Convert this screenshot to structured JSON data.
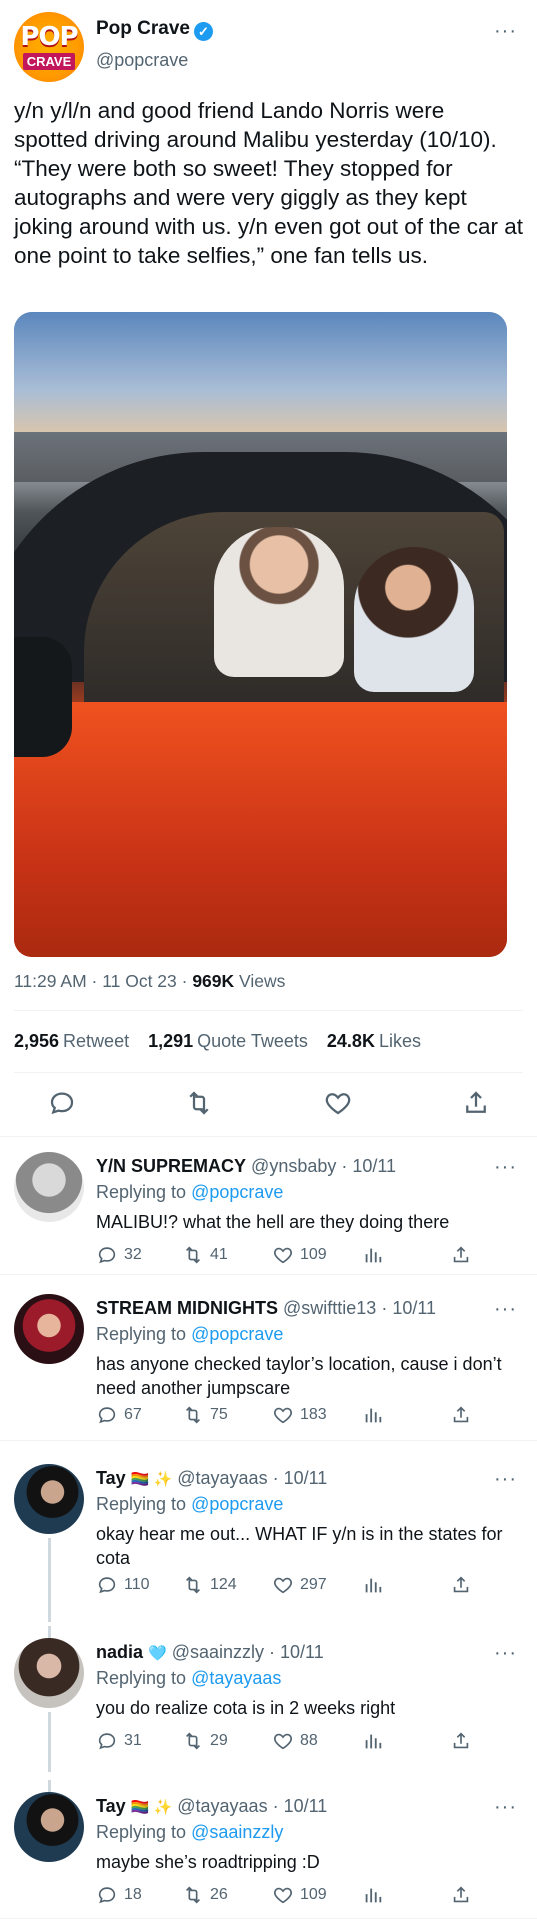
{
  "tweet": {
    "author_name": "Pop Crave",
    "author_handle": "@popcrave",
    "avatar_top": "POP",
    "avatar_bottom": "CRAVE",
    "text": "y/n y/l/n and good friend Lando Norris were spotted driving around Malibu yesterday (10/10). “They were both so sweet! They stopped for autographs and were very giggly as they kept joking around with us. y/n even got out of the car at one point to take selfies,” one fan tells us.",
    "time": "11:29 AM · 11 Oct 23 · ",
    "views_count": "969K",
    "views_label": "Views",
    "retweets_count": "2,956",
    "retweets_label": "Retweet",
    "quotes_count": "1,291",
    "quotes_label": "Quote Tweets",
    "likes_count": "24.8K",
    "likes_label": "Likes"
  },
  "replies": [
    {
      "name": "Y/N SUPREMACY",
      "handle": "@ynsbaby · 10/11",
      "replying_prefix": "Replying to ",
      "replying_to": "@popcrave",
      "text": "MALIBU!? what the hell are they doing there",
      "replies": "32",
      "retweets": "41",
      "likes": "109"
    },
    {
      "name": "STREAM MIDNIGHTS",
      "handle": "@swifttie13 · 10/11",
      "replying_prefix": "Replying to ",
      "replying_to": "@popcrave",
      "text": "has anyone checked taylor’s location, cause i don’t need another jumpscare",
      "replies": "67",
      "retweets": "75",
      "likes": "183"
    },
    {
      "name": "Tay",
      "name_emoji": "🏳️‍🌈 ✨",
      "handle": "@tayayaas · 10/11",
      "replying_prefix": "Replying to ",
      "replying_to": "@popcrave",
      "text": "okay hear me out... WHAT IF y/n is in the states for cota",
      "replies": "110",
      "retweets": "124",
      "likes": "297"
    },
    {
      "name": "nadia",
      "name_emoji": "🩵",
      "handle": "@saainzzly · 10/11",
      "replying_prefix": "Replying to ",
      "replying_to": "@tayayaas",
      "text": "you do realize cota is in 2 weeks right",
      "replies": "31",
      "retweets": "29",
      "likes": "88"
    },
    {
      "name": "Tay",
      "name_emoji": "🏳️‍🌈 ✨",
      "handle": "@tayayaas · 10/11",
      "replying_prefix": "Replying to ",
      "replying_to": "@saainzzly",
      "text": "maybe she’s roadtripping :D",
      "replies": "18",
      "retweets": "26",
      "likes": "109"
    }
  ],
  "more_glyph": "···",
  "colors": {
    "accent": "#1d9bf0",
    "muted": "#536471",
    "text": "#0f1419"
  }
}
